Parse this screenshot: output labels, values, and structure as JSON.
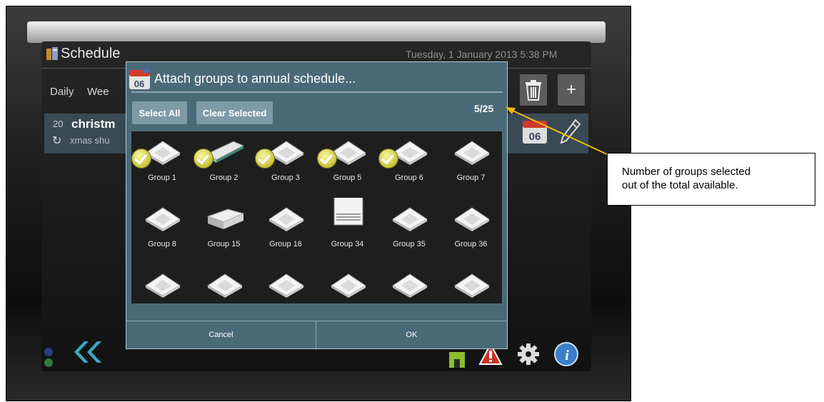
{
  "app": {
    "title": "Schedule",
    "datetime": "Tuesday, 1 January 2013 5:38 PM"
  },
  "tabs": [
    {
      "label": "Daily"
    },
    {
      "label": "Wee"
    }
  ],
  "toolbar": {
    "delete_icon": "trash-icon",
    "add_label": "+"
  },
  "schedule_row": {
    "number": "20",
    "name": "christm",
    "sub": "xmas shu",
    "calendar_day": "06"
  },
  "dialog": {
    "title": "Attach groups to annual schedule...",
    "calendar_day": "06",
    "select_all_label": "Select All",
    "clear_selected_label": "Clear Selected",
    "count": "5/25",
    "cancel_label": "Cancel",
    "ok_label": "OK",
    "groups": [
      {
        "label": "Group 1",
        "selected": true,
        "unit": "cassette"
      },
      {
        "label": "Group 2",
        "selected": true,
        "unit": "ceiling-duct"
      },
      {
        "label": "Group 3",
        "selected": true,
        "unit": "cassette"
      },
      {
        "label": "Group 5",
        "selected": true,
        "unit": "cassette"
      },
      {
        "label": "Group 6",
        "selected": true,
        "unit": "cassette"
      },
      {
        "label": "Group 7",
        "selected": false,
        "unit": "cassette"
      },
      {
        "label": "Group 8",
        "selected": false,
        "unit": "cassette"
      },
      {
        "label": "Group 15",
        "selected": false,
        "unit": "concealed"
      },
      {
        "label": "Group 16",
        "selected": false,
        "unit": "cassette"
      },
      {
        "label": "Group 34",
        "selected": false,
        "unit": "floor-standing"
      },
      {
        "label": "Group 35",
        "selected": false,
        "unit": "cassette"
      },
      {
        "label": "Group 36",
        "selected": false,
        "unit": "cassette"
      },
      {
        "label": "",
        "selected": false,
        "unit": "cassette"
      },
      {
        "label": "",
        "selected": false,
        "unit": "cassette"
      },
      {
        "label": "",
        "selected": false,
        "unit": "cassette"
      },
      {
        "label": "",
        "selected": false,
        "unit": "cassette"
      },
      {
        "label": "",
        "selected": false,
        "unit": "cassette"
      },
      {
        "label": "",
        "selected": false,
        "unit": "cassette"
      }
    ]
  },
  "callout": {
    "line1": "Number of groups selected",
    "line2": "out of the total available."
  },
  "colors": {
    "dialog_bg": "#4b6a78",
    "accent_arrow": "#f2b90c",
    "back_arrow": "#3aa9c4"
  }
}
